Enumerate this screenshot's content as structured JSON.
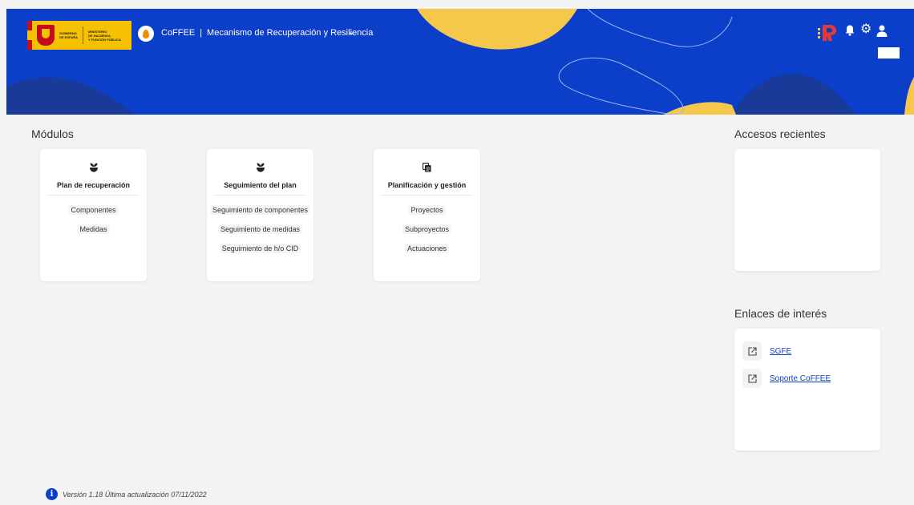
{
  "header": {
    "gov_line1": "GOBIERNO",
    "gov_line2": "DE ESPAÑA",
    "ministry_line1": "MINISTERIO",
    "ministry_line2": "DE HACIENDA",
    "ministry_line3": "Y FUNCIÓN PÚBLICA",
    "app_name": "CoFFEE",
    "separator": "|",
    "context_title": "Mecanismo de Recuperación y Resiliencia",
    "dropdown_icon": "chevron-down-icon",
    "icons": [
      "prtr-logo",
      "bell-icon",
      "gear-icon",
      "user-icon"
    ]
  },
  "modules": {
    "title": "Módulos",
    "cards": [
      {
        "title": "Plan de recuperación",
        "icon": "seedling-icon",
        "links": [
          "Componentes",
          "Medidas"
        ]
      },
      {
        "title": "Seguimiento del plan",
        "icon": "seedling-icon",
        "links": [
          "Seguimiento de componentes",
          "Seguimiento de medidas",
          "Seguimiento de h/o CID"
        ]
      },
      {
        "title": "Planificación y gestión",
        "icon": "copy-icon",
        "links": [
          "Proyectos",
          "Subproyectos",
          "Actuaciones"
        ]
      }
    ]
  },
  "recent": {
    "title": "Accesos recientes"
  },
  "links": {
    "title": "Enlaces de interés",
    "items": [
      {
        "label": "SGFE",
        "icon": "external-link-icon"
      },
      {
        "label": "Soporte CoFFEE",
        "icon": "external-link-icon"
      }
    ]
  },
  "footer": {
    "version_text": "Versión 1.18 Última actualización 07/11/2022",
    "icon": "info-icon"
  },
  "colors": {
    "primary": "#0b3fc9",
    "accent_yellow": "#f5c84c",
    "background": "#f3f3f3"
  }
}
